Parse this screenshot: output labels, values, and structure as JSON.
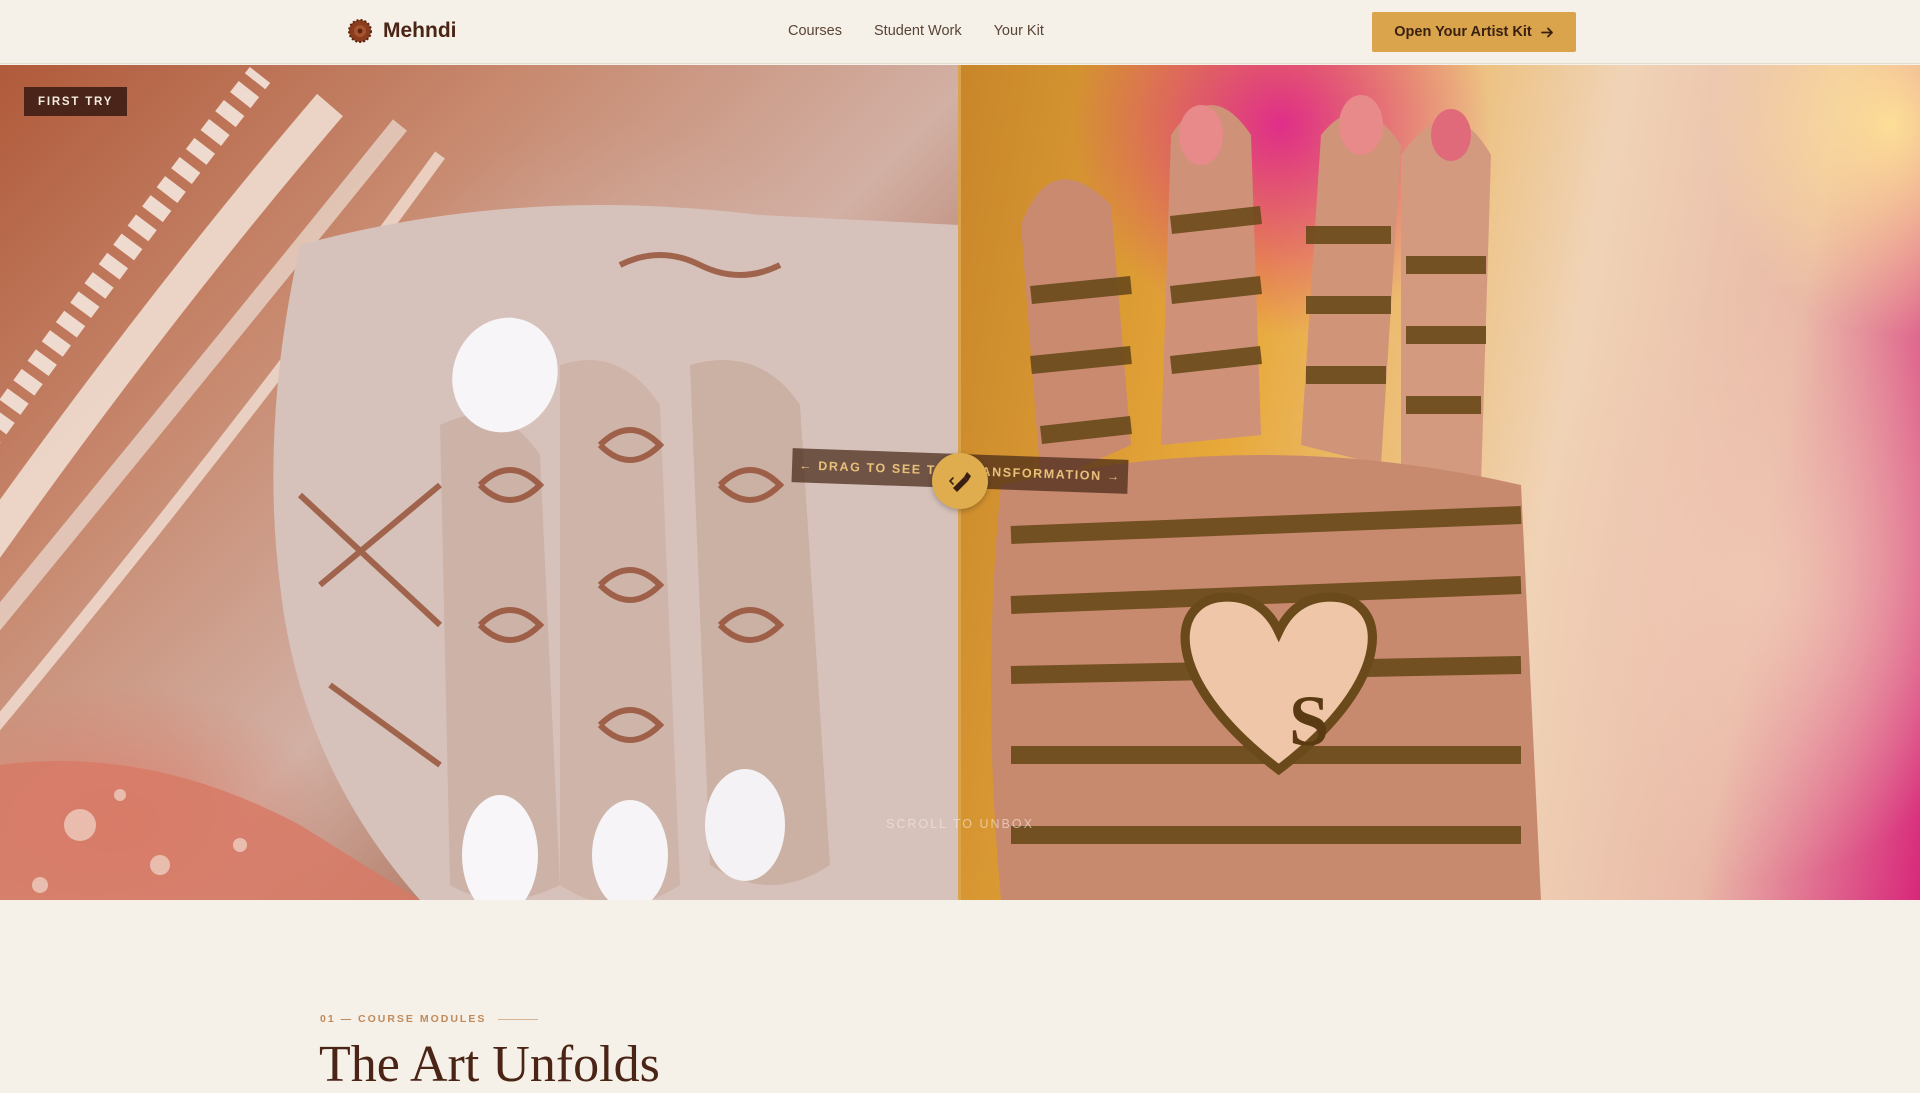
{
  "header": {
    "brand_name": "Mehndi",
    "brand_icon": "henna-flower-icon",
    "nav": [
      "Courses",
      "Student Work",
      "Your Kit"
    ],
    "cta_label": "Open Your Artist Kit",
    "cta_icon": "arrow-right-icon"
  },
  "hero": {
    "left_badge": "FIRST TRY",
    "drag_label": "← DRAG TO SEE THE TRANSFORMATION →",
    "handle_icon": "henna-cone-icon",
    "scroll_hint": "SCROLL TO UNBOX",
    "left_image": "hand with light henna pattern and pearl bangles",
    "right_image": "hand with dark henna pattern and heart with letter S"
  },
  "section": {
    "eyebrow": "01 — COURSE MODULES",
    "title": "The Art Unfolds"
  },
  "colors": {
    "accent": "#d9a44c",
    "brand_text": "#4a2516",
    "background": "#f5f0e8",
    "badge_bg": "#4a2418"
  }
}
